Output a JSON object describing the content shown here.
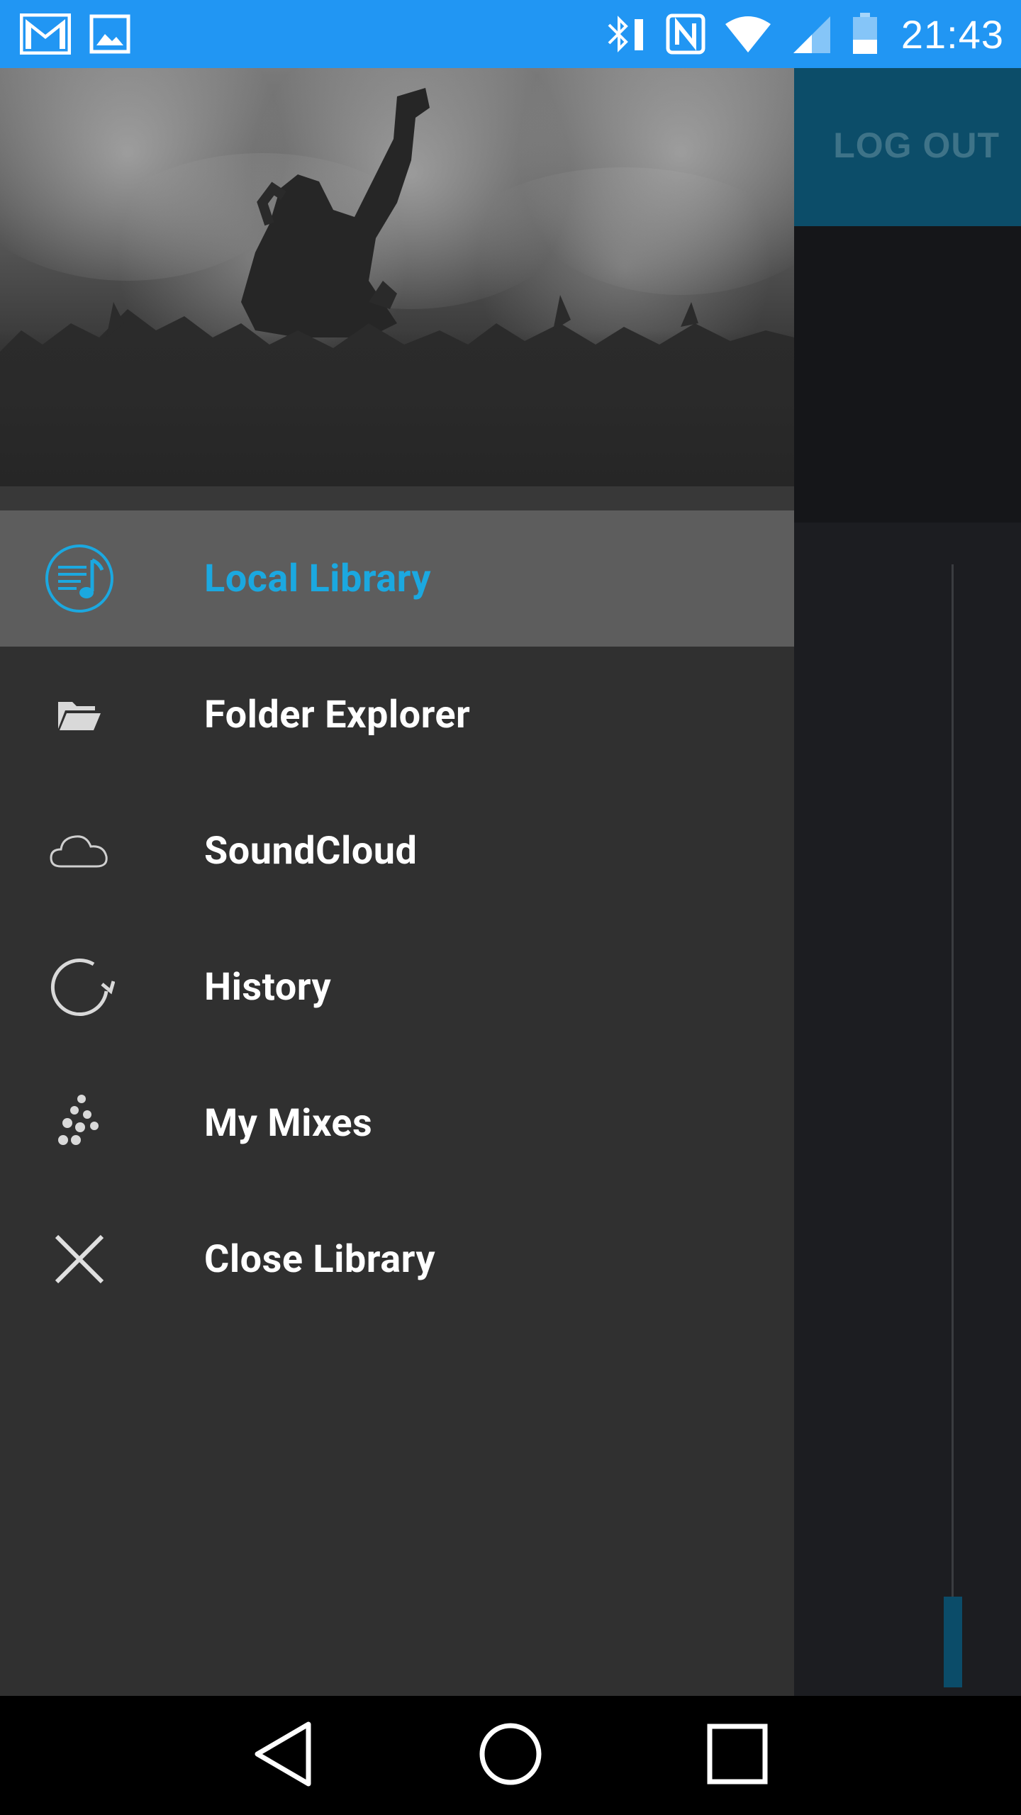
{
  "status_bar": {
    "time": "21:43",
    "icons": [
      "gmail-icon",
      "gallery-icon",
      "bluetooth-icon",
      "nfc-icon",
      "wifi-icon",
      "cell-signal-icon",
      "battery-icon"
    ]
  },
  "background_app": {
    "logout_label": "LOG OUT",
    "accent_color": "#0c4d69"
  },
  "drawer": {
    "header_image": "concert crowd photo",
    "items": [
      {
        "label": "Local Library",
        "icon": "music-library-icon",
        "active": true
      },
      {
        "label": "Folder Explorer",
        "icon": "folder-open-icon",
        "active": false
      },
      {
        "label": "SoundCloud",
        "icon": "cloud-icon",
        "active": false
      },
      {
        "label": "History",
        "icon": "history-refresh-icon",
        "active": false
      },
      {
        "label": "My Mixes",
        "icon": "mixes-dots-icon",
        "active": false
      },
      {
        "label": "Close Library",
        "icon": "close-icon",
        "active": false
      }
    ],
    "active_color": "#1ba8e0"
  },
  "nav_bar": {
    "buttons": [
      "back-button",
      "home-button",
      "recents-button"
    ]
  }
}
